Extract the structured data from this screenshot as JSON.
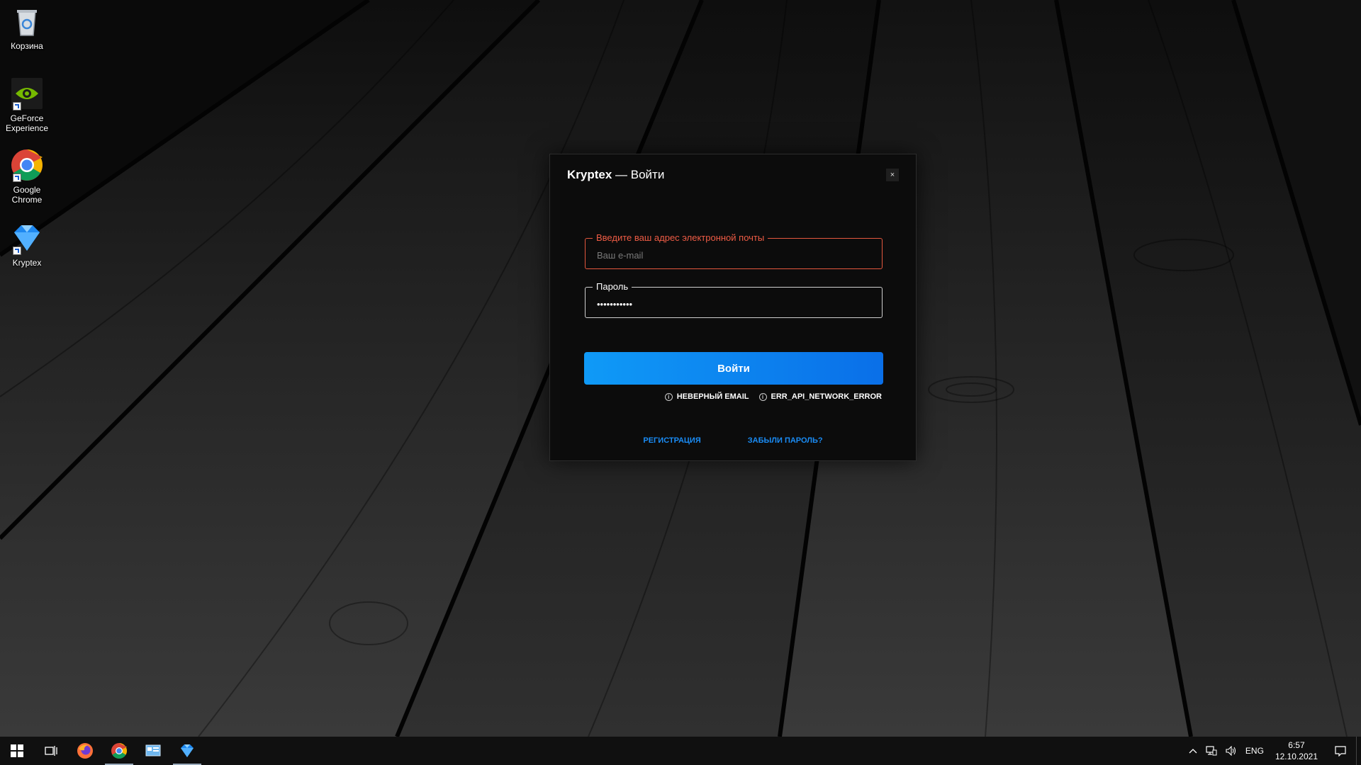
{
  "desktop": {
    "icons": [
      {
        "label": "Корзина",
        "icon": "recycle-bin-icon"
      },
      {
        "label": "GeForce Experience",
        "icon": "geforce-experience-icon"
      },
      {
        "label": "Google Chrome",
        "icon": "chrome-icon"
      },
      {
        "label": "Kryptex",
        "icon": "kryptex-icon"
      }
    ]
  },
  "dialog": {
    "title_app": "Kryptex",
    "title_sep": " — ",
    "title_action": "Войти",
    "close_label": "×",
    "email": {
      "label": "Введите ваш адрес электронной почты",
      "placeholder": "Ваш e-mail",
      "value": ""
    },
    "password": {
      "label": "Пароль",
      "value": "•••••••••••"
    },
    "login_button": "Войти",
    "errors": [
      "НЕВЕРНЫЙ EMAIL",
      "ERR_API_NETWORK_ERROR"
    ],
    "links": {
      "register": "РЕГИСТРАЦИЯ",
      "forgot": "ЗАБЫЛИ ПАРОЛЬ?"
    }
  },
  "taskbar": {
    "apps": [
      "start-icon",
      "task-view-icon",
      "firefox-icon",
      "chrome-icon",
      "control-panel-icon",
      "kryptex-icon"
    ],
    "tray": {
      "language": "ENG",
      "time": "6:57",
      "date": "12.10.2021"
    }
  },
  "colors": {
    "accent": "#0f9af7",
    "error": "#e4573e",
    "link": "#1a8cf5"
  }
}
